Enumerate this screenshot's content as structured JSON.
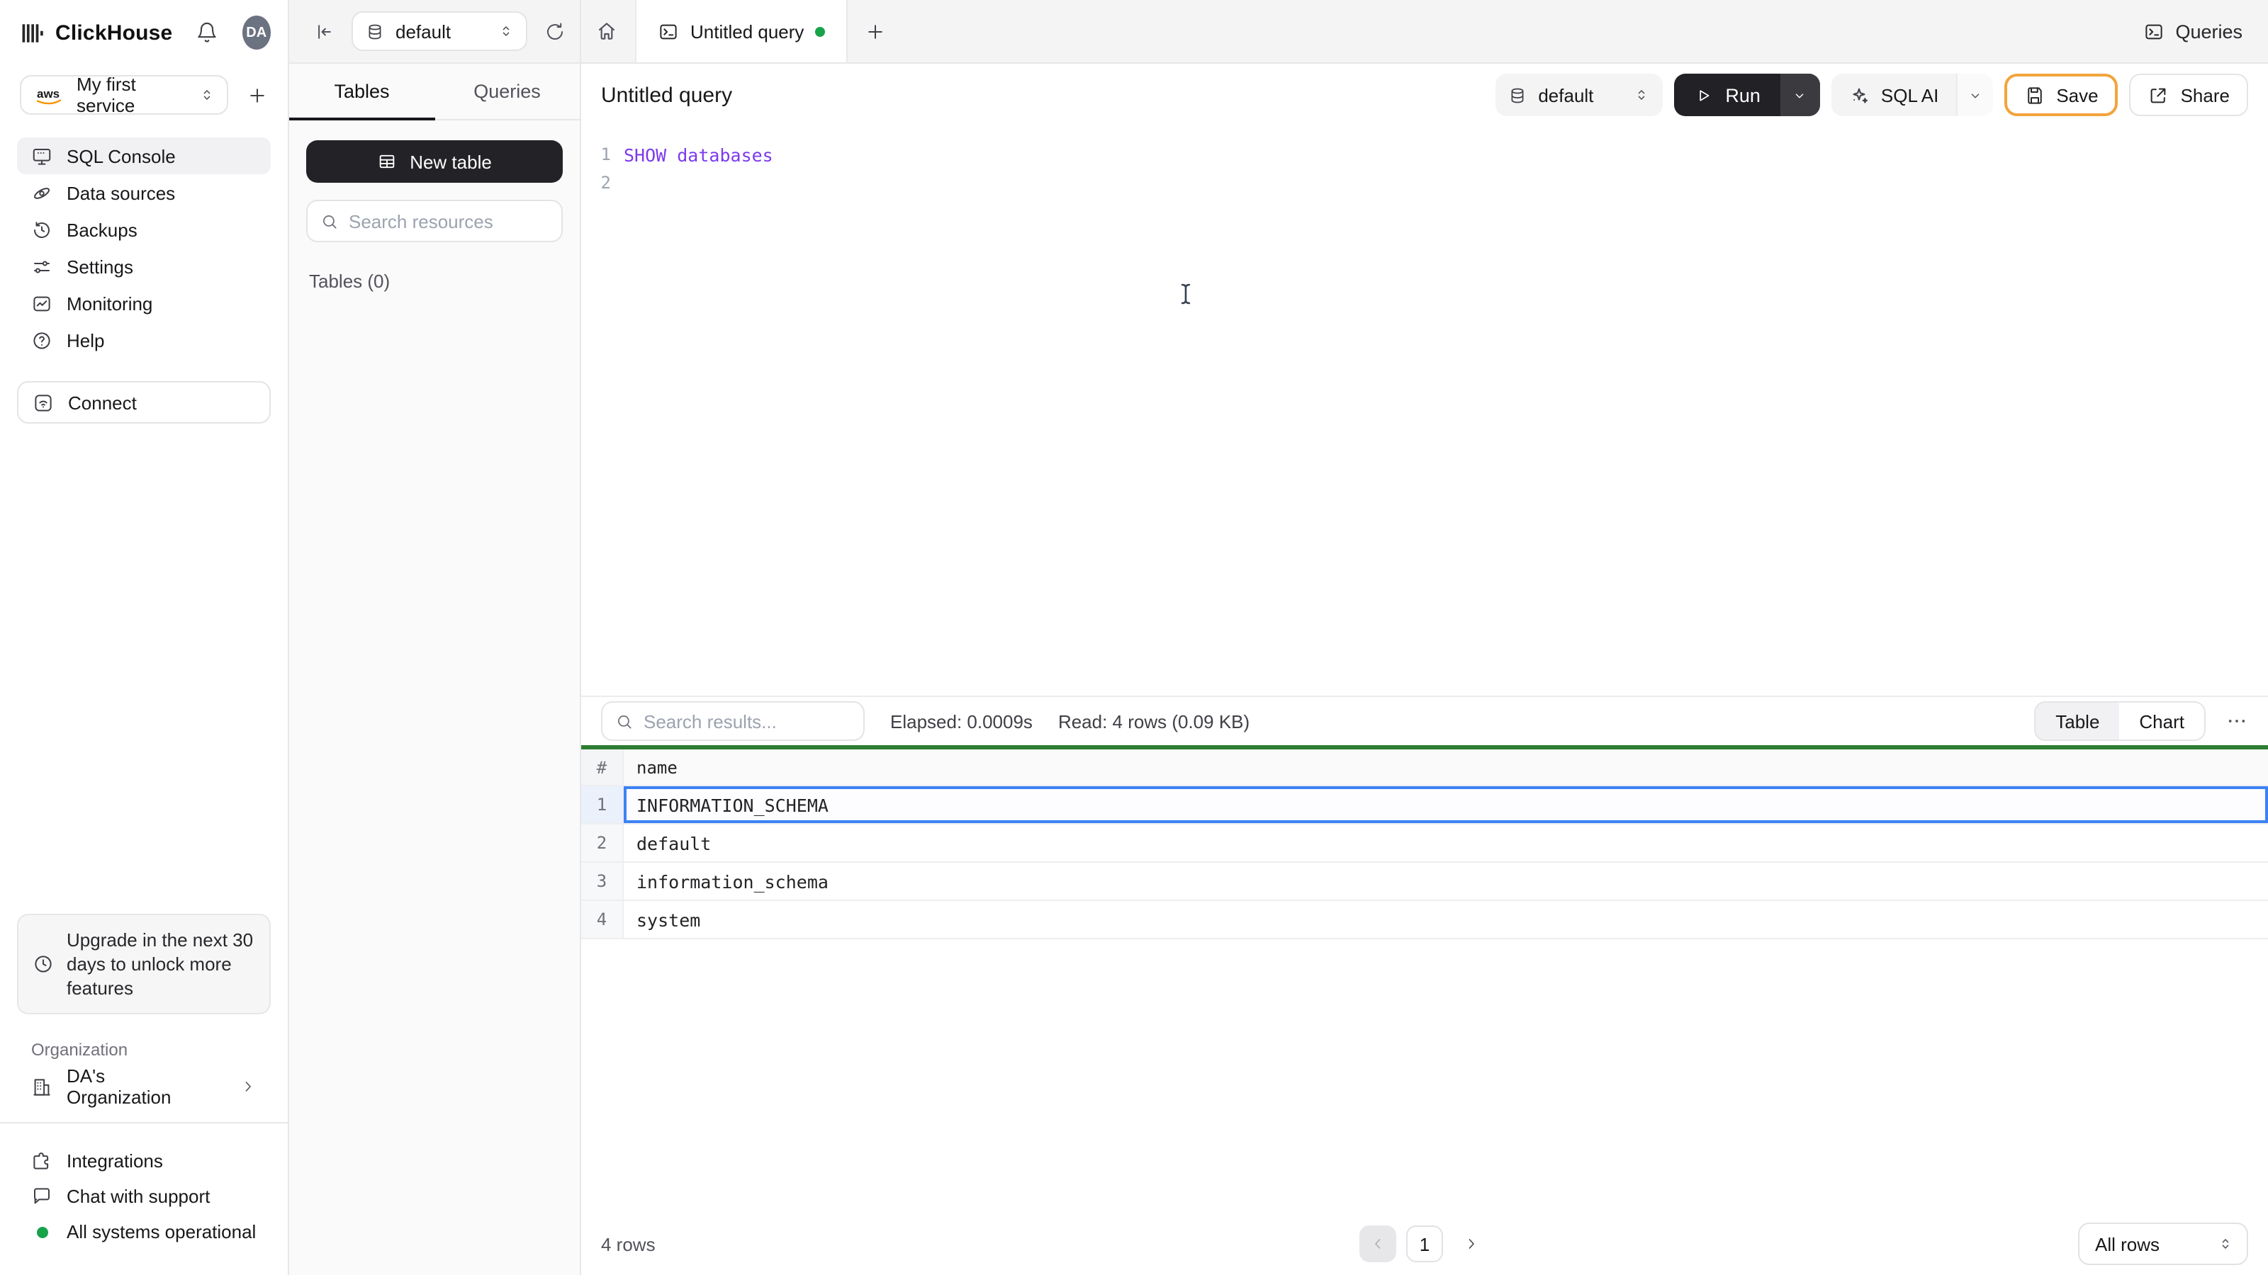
{
  "sidebar": {
    "brand": "ClickHouse",
    "avatar_initials": "DA",
    "service_selector": "My first service",
    "nav_items": [
      {
        "label": "SQL Console"
      },
      {
        "label": "Data sources"
      },
      {
        "label": "Backups"
      },
      {
        "label": "Settings"
      },
      {
        "label": "Monitoring"
      },
      {
        "label": "Help"
      }
    ],
    "connect_label": "Connect",
    "upgrade_notice": "Upgrade in the next 30 days to unlock more features",
    "organization": {
      "section_label": "Organization",
      "name": "DA's Organization"
    },
    "links": {
      "integrations": "Integrations",
      "chat": "Chat with support"
    },
    "status": "All systems operational"
  },
  "topbar": {
    "database_selector": "default",
    "tab_title": "Untitled query",
    "queries_button": "Queries"
  },
  "tables_panel": {
    "tabs": [
      "Tables",
      "Queries"
    ],
    "new_table_button": "New table",
    "search_placeholder": "Search resources",
    "section_label": "Tables (0)"
  },
  "query": {
    "title": "Untitled query",
    "database_selector": "default",
    "run_button": "Run",
    "sql_ai_button": "SQL AI",
    "save_button": "Save",
    "share_button": "Share",
    "lines": [
      {
        "num": "1",
        "code": "SHOW databases"
      },
      {
        "num": "2",
        "code": ""
      }
    ]
  },
  "results": {
    "search_placeholder": "Search results...",
    "elapsed": "Elapsed: 0.0009s",
    "read": "Read: 4 rows (0.09 KB)",
    "view_toggle": [
      "Table",
      "Chart"
    ],
    "columns": {
      "index": "#",
      "name": "name"
    },
    "rows": [
      {
        "num": "1",
        "name": "INFORMATION_SCHEMA"
      },
      {
        "num": "2",
        "name": "default"
      },
      {
        "num": "3",
        "name": "information_schema"
      },
      {
        "num": "4",
        "name": "system"
      }
    ],
    "selected_row_index": 0,
    "footer": {
      "row_count": "4 rows",
      "page": "1",
      "page_size": "All rows"
    }
  },
  "colors": {
    "status_green": "#16A34A",
    "progress_green": "#2E7D32",
    "selected_row_blue": "#3B82F6",
    "save_focus_ring": "#F2A43B",
    "sql_keyword_purple": "#7C3AED",
    "run_button_bg": "#212126"
  }
}
